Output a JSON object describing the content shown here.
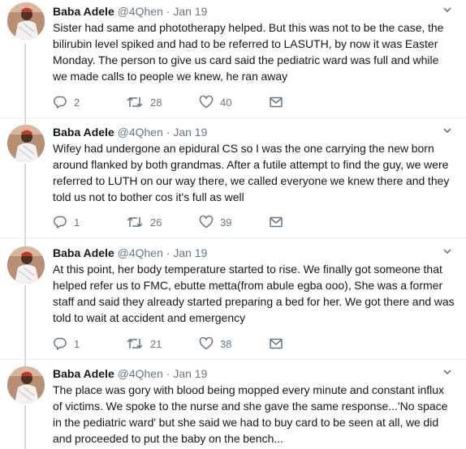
{
  "tweets": [
    {
      "name": "Baba Adele",
      "handle": "@4Qhen",
      "separator": "·",
      "time": "Jan 19",
      "text": "Sister had same and phototherapy helped. But this was not to be the case, the bilirubin level spiked and had to be referred to LASUTH, by now it was Easter Monday. The person to give us card said the pediatric ward was full and while we made calls to people we knew, he ran away",
      "replies": "2",
      "retweets": "28",
      "likes": "40"
    },
    {
      "name": "Baba Adele",
      "handle": "@4Qhen",
      "separator": "·",
      "time": "Jan 19",
      "text": "Wifey had undergone an epidural CS so I was the one carrying the new born around flanked by both grandmas. After a futile attempt to find the guy, we were referred to LUTH on our way there, we called everyone we knew there and they told us not to bother cos it's full as well",
      "replies": "1",
      "retweets": "26",
      "likes": "39"
    },
    {
      "name": "Baba Adele",
      "handle": "@4Qhen",
      "separator": "·",
      "time": "Jan 19",
      "text": "At this point, her body temperature started to rise. We finally got someone that helped refer us to FMC, ebutte metta(from abule egba ooo), She was a former staff and said they already started preparing a bed for her. We got there and was told to wait at accident and emergency",
      "replies": "1",
      "retweets": "21",
      "likes": "38"
    },
    {
      "name": "Baba Adele",
      "handle": "@4Qhen",
      "separator": "·",
      "time": "Jan 19",
      "text": "The place was gory with blood being mopped every minute and constant influx of victims. We spoke to the nurse and  she gave the same response...'No space in the pediatric ward' but she said we had to buy card to be seen at all, we did and proceeded to put the baby on the bench..."
    }
  ],
  "icons": {
    "reply": "reply-icon",
    "retweet": "retweet-icon",
    "like": "heart-icon",
    "message": "envelope-icon",
    "menu": "chevron-down-icon"
  },
  "colors": {
    "text": "#14171a",
    "secondary": "#657786",
    "divider": "#e6ecf0",
    "thread_line": "#cfd9de"
  }
}
